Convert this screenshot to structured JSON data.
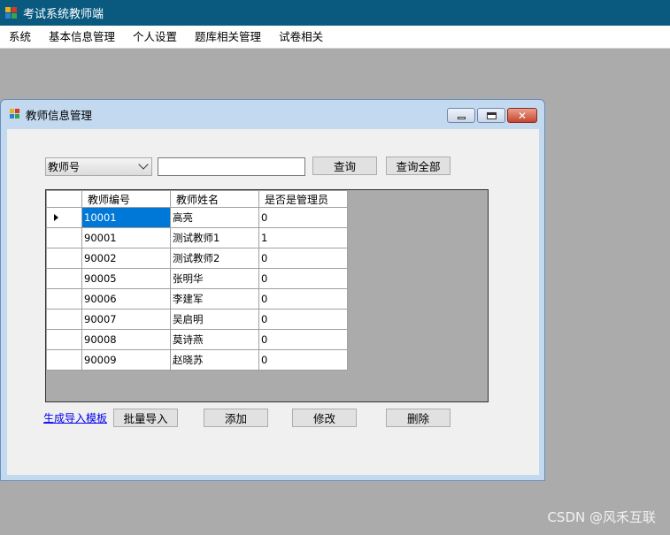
{
  "app": {
    "title": "考试系统教师端"
  },
  "menu": [
    "系统",
    "基本信息管理",
    "个人设置",
    "题库相关管理",
    "试卷相关"
  ],
  "child": {
    "title": "教师信息管理",
    "close_glyph": "✕"
  },
  "search": {
    "field_selected": "教师号",
    "query_value": "",
    "query_label": "查询",
    "query_all_label": "查询全部"
  },
  "grid": {
    "columns": [
      "教师编号",
      "教师姓名",
      "是否是管理员"
    ],
    "rows": [
      [
        "10001",
        "高亮",
        "0"
      ],
      [
        "90001",
        "测试教师1",
        "1"
      ],
      [
        "90002",
        "测试教师2",
        "0"
      ],
      [
        "90005",
        "张明华",
        "0"
      ],
      [
        "90006",
        "李建军",
        "0"
      ],
      [
        "90007",
        "吴启明",
        "0"
      ],
      [
        "90008",
        "莫诗燕",
        "0"
      ],
      [
        "90009",
        "赵晓苏",
        "0"
      ]
    ]
  },
  "actions": {
    "template_link": "生成导入模板",
    "batch_import": "批量导入",
    "add": "添加",
    "edit": "修改",
    "delete": "删除"
  },
  "watermark": "CSDN @风禾互联",
  "colors": {
    "titlebar": "#0a5a80",
    "selection": "#0078d7",
    "mdi": "#ababab"
  }
}
